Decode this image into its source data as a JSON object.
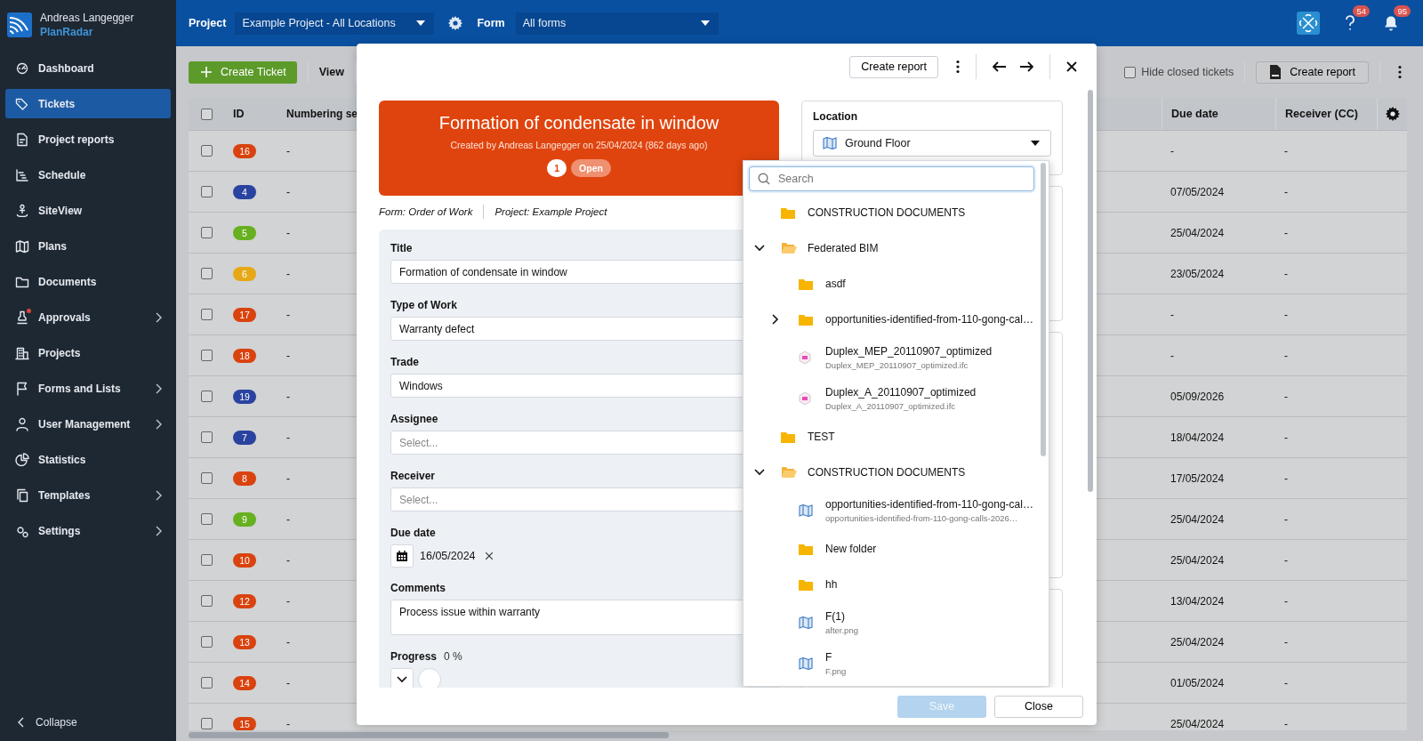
{
  "user": {
    "name": "Andreas Langegger",
    "brand": "PlanRadar"
  },
  "nav": [
    {
      "label": "Dashboard",
      "selected": false,
      "submenu": false,
      "alert": false
    },
    {
      "label": "Tickets",
      "selected": true,
      "submenu": false,
      "alert": false
    },
    {
      "label": "Project reports",
      "selected": false,
      "submenu": false,
      "alert": false
    },
    {
      "label": "Schedule",
      "selected": false,
      "submenu": false,
      "alert": false
    },
    {
      "label": "SiteView",
      "selected": false,
      "submenu": false,
      "alert": false
    },
    {
      "label": "Plans",
      "selected": false,
      "submenu": false,
      "alert": false
    },
    {
      "label": "Documents",
      "selected": false,
      "submenu": false,
      "alert": false
    },
    {
      "label": "Approvals",
      "selected": false,
      "submenu": true,
      "alert": true
    },
    {
      "label": "Projects",
      "selected": false,
      "submenu": false,
      "alert": false
    },
    {
      "label": "Forms and Lists",
      "selected": false,
      "submenu": true,
      "alert": false
    },
    {
      "label": "User Management",
      "selected": false,
      "submenu": true,
      "alert": false
    },
    {
      "label": "Statistics",
      "selected": false,
      "submenu": false,
      "alert": false
    },
    {
      "label": "Templates",
      "selected": false,
      "submenu": true,
      "alert": false
    },
    {
      "label": "Settings",
      "selected": false,
      "submenu": true,
      "alert": false
    }
  ],
  "collapse": "Collapse",
  "topbar": {
    "project_label": "Project",
    "project_value": "Example Project - All Locations",
    "form_label": "Form",
    "form_value": "All forms",
    "help_badge": "54",
    "notifications_badge": "95"
  },
  "toolbar": {
    "create_ticket": "Create Ticket",
    "view_label": "View",
    "hide_closed": {
      "label": "Hide closed tickets",
      "checked": false
    },
    "create_report": "Create report"
  },
  "table": {
    "select_all_checked": false,
    "columns": [
      "ID",
      "Numbering se",
      "Due date",
      "Receiver (CC)"
    ],
    "rows": [
      {
        "id": "16",
        "color": "#d9430f",
        "numbering": "-",
        "due_date": "-",
        "receiver": "-",
        "checked": false
      },
      {
        "id": "4",
        "color": "#2a43a0",
        "numbering": "-",
        "due_date": "07/05/2024",
        "receiver": "-",
        "checked": false
      },
      {
        "id": "5",
        "color": "#67b020",
        "numbering": "-",
        "due_date": "25/04/2024",
        "receiver": "-",
        "checked": false
      },
      {
        "id": "6",
        "color": "#e6a817",
        "numbering": "-",
        "due_date": "23/05/2024",
        "receiver": "-",
        "checked": false
      },
      {
        "id": "17",
        "color": "#d9430f",
        "numbering": "-",
        "due_date": "-",
        "receiver": "-",
        "checked": false
      },
      {
        "id": "18",
        "color": "#d9430f",
        "numbering": "-",
        "due_date": "-",
        "receiver": "-",
        "checked": false
      },
      {
        "id": "19",
        "color": "#2a43a0",
        "numbering": "-",
        "due_date": "05/09/2026",
        "receiver": "-",
        "checked": false
      },
      {
        "id": "7",
        "color": "#2a43a0",
        "numbering": "-",
        "due_date": "18/04/2024",
        "receiver": "-",
        "checked": false
      },
      {
        "id": "8",
        "color": "#d9430f",
        "numbering": "-",
        "due_date": "17/05/2024",
        "receiver": "-",
        "checked": false
      },
      {
        "id": "9",
        "color": "#67b020",
        "numbering": "-",
        "due_date": "25/04/2024",
        "receiver": "-",
        "checked": false
      },
      {
        "id": "10",
        "color": "#d9430f",
        "numbering": "-",
        "due_date": "25/04/2024",
        "receiver": "-",
        "checked": false
      },
      {
        "id": "12",
        "color": "#d9430f",
        "numbering": "-",
        "due_date": "13/04/2024",
        "receiver": "-",
        "checked": false
      },
      {
        "id": "13",
        "color": "#d9430f",
        "numbering": "-",
        "due_date": "25/04/2024",
        "receiver": "-",
        "checked": false
      },
      {
        "id": "14",
        "color": "#d9430f",
        "numbering": "-",
        "due_date": "01/05/2024",
        "receiver": "-",
        "checked": false
      },
      {
        "id": "15",
        "color": "#d9430f",
        "numbering": "-",
        "due_date": "25/04/2024",
        "receiver": "-",
        "checked": false
      }
    ]
  },
  "modal": {
    "create_report": "Create report",
    "ticket": {
      "title": "Formation of condensate in window",
      "created": "Created by Andreas Langegger on 25/04/2024 (862 days ago)",
      "number": "1",
      "status": "Open",
      "form": "Form: Order of Work",
      "project": "Project: Example Project"
    },
    "fields": [
      {
        "kind": "text",
        "label": "Title",
        "value": "Formation of condensate in window"
      },
      {
        "kind": "select",
        "label": "Type of Work",
        "value": "Warranty defect"
      },
      {
        "kind": "select",
        "label": "Trade",
        "value": "Windows"
      },
      {
        "kind": "select",
        "label": "Assignee",
        "placeholder": "Select..."
      },
      {
        "kind": "select",
        "label": "Receiver",
        "placeholder": "Select..."
      },
      {
        "kind": "date",
        "label": "Due date",
        "value": "16/05/2024"
      },
      {
        "kind": "textarea",
        "label": "Comments",
        "value": "Process issue within warranty"
      },
      {
        "kind": "progress",
        "label": "Progress",
        "reading": "0 %"
      }
    ],
    "location": {
      "label": "Location",
      "value": "Ground Floor"
    },
    "dropdown": {
      "placeholder": "Search",
      "tree": [
        {
          "kind": "folder",
          "label": "CONSTRUCTION DOCUMENTS"
        },
        {
          "kind": "folder",
          "label": "Federated BIM",
          "expanded": true,
          "children": [
            {
              "kind": "folder",
              "label": "asdf"
            },
            {
              "kind": "folder",
              "label": "opportunities-identified-from-110-gong-cal…",
              "expanded": false
            },
            {
              "kind": "bim",
              "label": "Duplex_MEP_20110907_optimized",
              "file": "Duplex_MEP_20110907_optimized.ifc"
            },
            {
              "kind": "bim",
              "label": "Duplex_A_20110907_optimized",
              "file": "Duplex_A_20110907_optimized.ifc"
            }
          ]
        },
        {
          "kind": "folder",
          "label": "TEST"
        },
        {
          "kind": "folder",
          "label": "CONSTRUCTION DOCUMENTS",
          "expanded": true,
          "children": [
            {
              "kind": "plan",
              "label": "opportunities-identified-from-110-gong-cal…",
              "file": "opportunities-identified-from-110-gong-calls-2026…"
            },
            {
              "kind": "folder",
              "label": "New folder"
            },
            {
              "kind": "folder",
              "label": "hh"
            },
            {
              "kind": "plan",
              "label": "F(1)",
              "file": "after.png"
            },
            {
              "kind": "plan",
              "label": "F",
              "file": "F.png"
            }
          ]
        }
      ]
    },
    "footer": {
      "save": {
        "label": "Save",
        "disabled": true
      },
      "close": "Close"
    }
  }
}
